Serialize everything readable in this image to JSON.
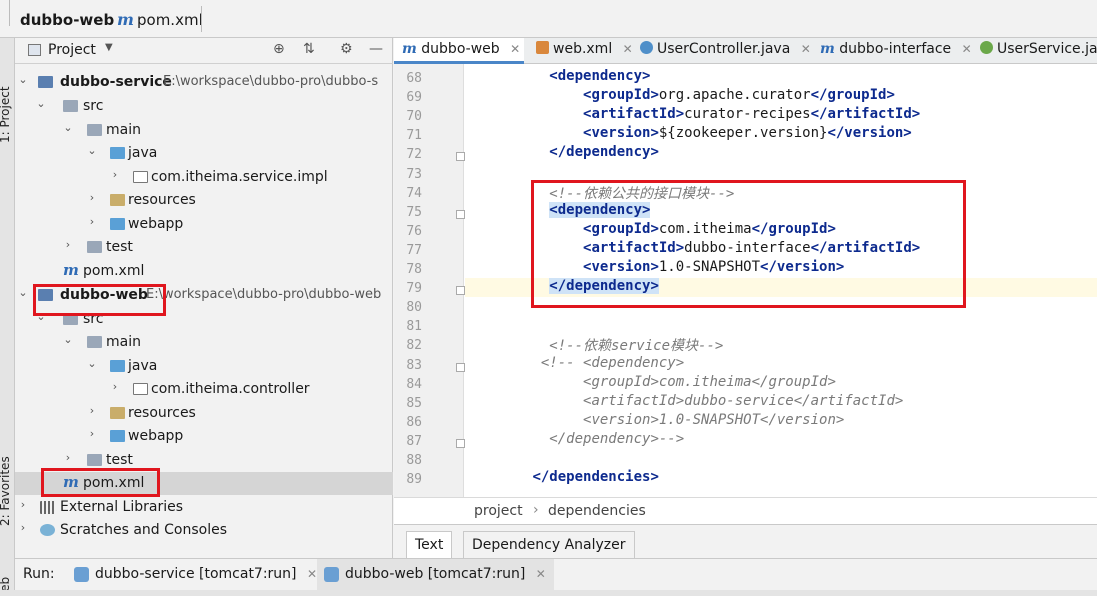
{
  "breadcrumb": {
    "project": "dubbo-web",
    "file": "pom.xml",
    "file_icon": "m"
  },
  "project_panel": {
    "title": "Project",
    "tree": [
      {
        "label": "dubbo-service",
        "path": "E:\\workspace\\dubbo-pro\\dubbo-s"
      },
      {
        "label": "src"
      },
      {
        "label": "main"
      },
      {
        "label": "java"
      },
      {
        "label": "com.itheima.service.impl"
      },
      {
        "label": "resources"
      },
      {
        "label": "webapp"
      },
      {
        "label": "test"
      },
      {
        "label": "pom.xml",
        "icon": "m"
      },
      {
        "label": "dubbo-web",
        "path": "E:\\workspace\\dubbo-pro\\dubbo-web"
      },
      {
        "label": "src"
      },
      {
        "label": "main"
      },
      {
        "label": "java"
      },
      {
        "label": "com.itheima.controller"
      },
      {
        "label": "resources"
      },
      {
        "label": "webapp"
      },
      {
        "label": "test"
      },
      {
        "label": "pom.xml",
        "icon": "m"
      },
      {
        "label": "External Libraries"
      },
      {
        "label": "Scratches and Consoles"
      }
    ]
  },
  "side_labels": {
    "project": "1: Project",
    "favorites": "2: Favorites",
    "web": "Web"
  },
  "editor": {
    "tabs": [
      {
        "label": "dubbo-web",
        "icon": "m"
      },
      {
        "label": "web.xml"
      },
      {
        "label": "UserController.java"
      },
      {
        "label": "dubbo-interface",
        "icon": "m"
      },
      {
        "label": "UserService.java"
      }
    ],
    "line_numbers": [
      "68",
      "69",
      "70",
      "71",
      "72",
      "73",
      "74",
      "75",
      "76",
      "77",
      "78",
      "79",
      "80",
      "81",
      "82",
      "83",
      "84",
      "85",
      "86",
      "87",
      "88",
      "89"
    ],
    "lines": [
      {
        "parts": [
          [
            "tg",
            "<dependency>"
          ]
        ]
      },
      {
        "parts": [
          [
            "tg",
            "<groupId>"
          ],
          [
            "tx",
            "org.apache.curator"
          ],
          [
            "tg",
            "</groupId>"
          ]
        ]
      },
      {
        "parts": [
          [
            "tg",
            "<artifactId>"
          ],
          [
            "tx",
            "curator-recipes"
          ],
          [
            "tg",
            "</artifactId>"
          ]
        ]
      },
      {
        "parts": [
          [
            "tg",
            "<version>"
          ],
          [
            "tx",
            "${zookeeper.version}"
          ],
          [
            "tg",
            "</version>"
          ]
        ]
      },
      {
        "parts": [
          [
            "tg",
            "</dependency>"
          ]
        ]
      },
      {
        "parts": []
      },
      {
        "parts": [
          [
            "cm",
            "<!--依赖公共的接口模块-->"
          ]
        ]
      },
      {
        "parts": [
          [
            "tg hl",
            "<dependency>"
          ]
        ]
      },
      {
        "parts": [
          [
            "tg",
            "<groupId>"
          ],
          [
            "tx",
            "com.itheima"
          ],
          [
            "tg",
            "</groupId>"
          ]
        ]
      },
      {
        "parts": [
          [
            "tg",
            "<artifactId>"
          ],
          [
            "tx",
            "dubbo-interface"
          ],
          [
            "tg",
            "</artifactId>"
          ]
        ]
      },
      {
        "parts": [
          [
            "tg",
            "<version>"
          ],
          [
            "tx",
            "1.0-SNAPSHOT"
          ],
          [
            "tg",
            "</version>"
          ]
        ]
      },
      {
        "parts": [
          [
            "tg hl",
            "</dependency>"
          ]
        ]
      },
      {
        "parts": []
      },
      {
        "parts": []
      },
      {
        "parts": [
          [
            "cm",
            "<!--依赖service模块-->"
          ]
        ]
      },
      {
        "parts": [
          [
            "cm",
            "<!-- <dependency>"
          ]
        ]
      },
      {
        "parts": [
          [
            "cm",
            "<groupId>com.itheima</groupId>"
          ]
        ]
      },
      {
        "parts": [
          [
            "cm",
            "<artifactId>dubbo-service</artifactId>"
          ]
        ]
      },
      {
        "parts": [
          [
            "cm",
            "<version>1.0-SNAPSHOT</version>"
          ]
        ]
      },
      {
        "parts": [
          [
            "cm",
            "</dependency>-->"
          ]
        ]
      },
      {
        "parts": []
      },
      {
        "parts": [
          [
            "tg",
            "</dependencies>"
          ]
        ]
      }
    ],
    "breadcrumb": {
      "project": "project",
      "dependencies": "dependencies"
    }
  },
  "bottom_tabs": {
    "text": "Text",
    "analyzer": "Dependency Analyzer"
  },
  "run_bar": {
    "label": "Run:",
    "tabs": [
      {
        "label": "dubbo-service [tomcat7:run]"
      },
      {
        "label": "dubbo-web [tomcat7:run]"
      }
    ]
  },
  "colors": {
    "highlight_box": "#e0161e",
    "tag": "#0d2a8e",
    "comment": "#7a7a7a",
    "selection": "#cfe3f7"
  }
}
